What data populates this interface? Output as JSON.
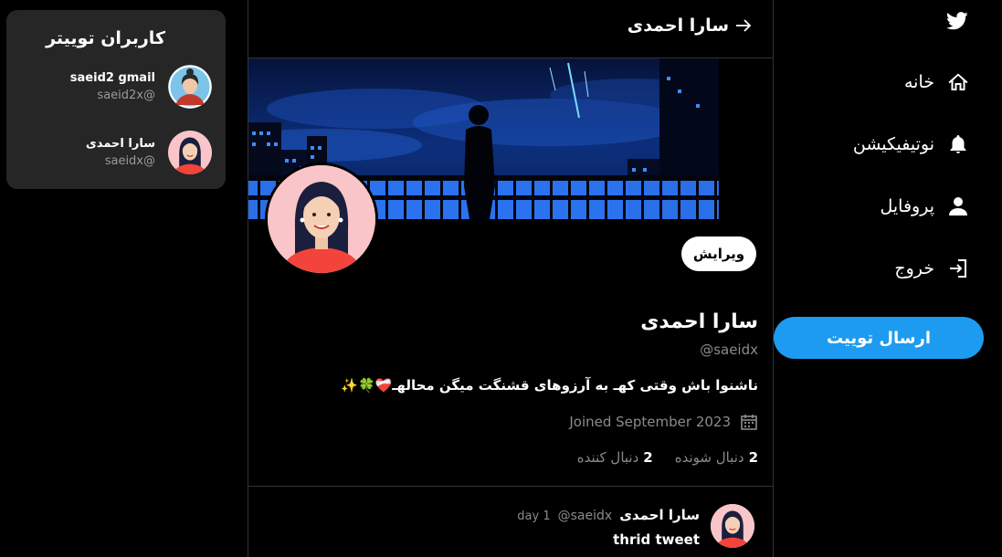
{
  "nav": {
    "logo": "twitter-bird-icon",
    "items": [
      {
        "label": "خانه",
        "icon": "home-icon"
      },
      {
        "label": "نوتیفیکیشن",
        "icon": "bell-icon"
      },
      {
        "label": "پروفایل",
        "icon": "user-icon"
      },
      {
        "label": "خروج",
        "icon": "logout-icon"
      }
    ],
    "tweet_button": "ارسال توییت"
  },
  "header": {
    "title": "سارا احمدی",
    "back_icon": "arrow-right-icon"
  },
  "profile": {
    "edit_button": "ویرایش",
    "name": "سارا احمدی",
    "handle": "saeidx@",
    "bio": "ناشنوا باش وقتی کهـ به آرزوهای قشنگت میگن محالهـ❤️‍🩹🍀✨",
    "joined": "Joined September 2023",
    "following_count": "2",
    "following_label": "دنبال شونده",
    "followers_count": "2",
    "followers_label": "دنبال کننده"
  },
  "tweets": [
    {
      "name": "سارا احمدی",
      "handle": "saeidx@",
      "time": "1 day",
      "text": "thrid tweet"
    }
  ],
  "users_panel": {
    "title": "کاربران توییتر",
    "users": [
      {
        "name": "saeid2 gmail",
        "handle": "saeid2x@"
      },
      {
        "name": "سارا احمدی",
        "handle": "saeidx@"
      }
    ]
  },
  "colors": {
    "accent": "#1d9bf0",
    "background": "#000000",
    "panel": "#262626"
  }
}
